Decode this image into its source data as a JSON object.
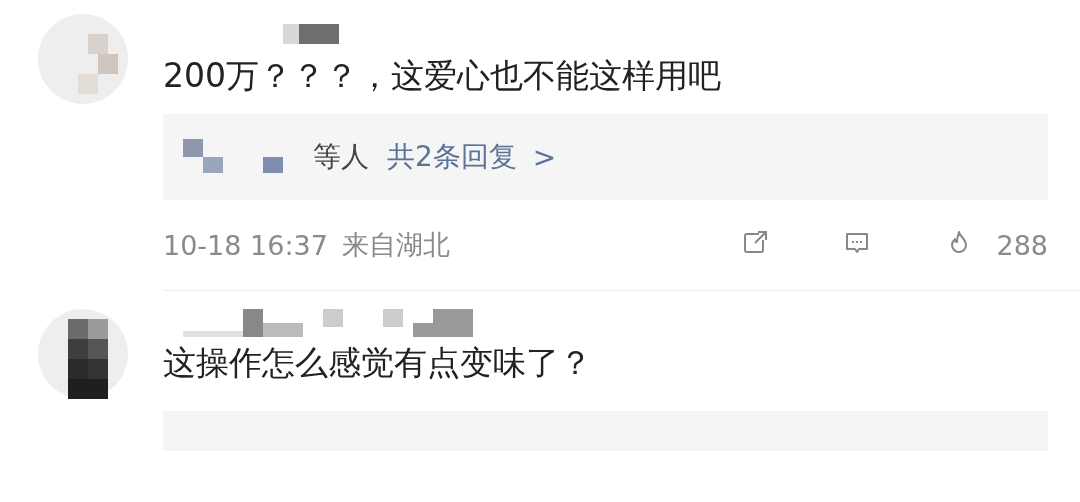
{
  "comments": [
    {
      "text": "200万？？？，这爱心也不能这样用吧",
      "replies": {
        "names_suffix": "等人",
        "count_link": "共2条回复",
        "chevron": ">"
      },
      "time": "10-18 16:37",
      "location": "来自湖北",
      "likes": "288"
    },
    {
      "text": "这操作怎么感觉有点变味了？"
    }
  ]
}
